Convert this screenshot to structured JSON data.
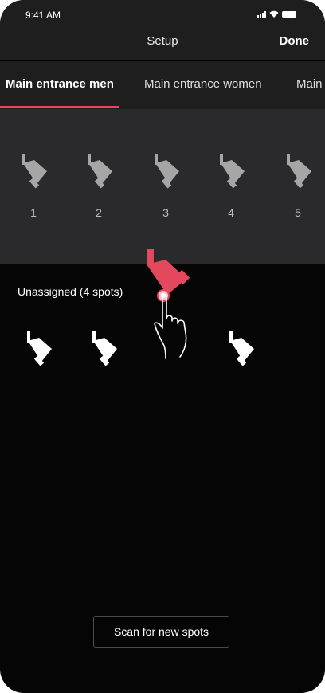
{
  "status_bar": {
    "time": "9:41 AM",
    "icons": [
      "signal-icon",
      "wifi-icon",
      "battery-icon"
    ]
  },
  "nav": {
    "title": "Setup",
    "done_label": "Done"
  },
  "tabs": [
    {
      "label": "Main entrance men",
      "active": true
    },
    {
      "label": "Main entrance women",
      "active": false
    },
    {
      "label": "Main",
      "active": false
    }
  ],
  "assigned_slots": [
    {
      "label": "1",
      "icon": "spotlight-icon"
    },
    {
      "label": "2",
      "icon": "spotlight-icon"
    },
    {
      "label": "3",
      "icon": "spotlight-icon"
    },
    {
      "label": "4",
      "icon": "spotlight-icon"
    },
    {
      "label": "5",
      "icon": "spotlight-icon"
    }
  ],
  "unassigned": {
    "label": "Unassigned (4 spots)",
    "visible_spots": 3
  },
  "scan_button": {
    "label": "Scan for new spots"
  },
  "colors": {
    "accent": "#e3485c",
    "assigned_spot": "#a6a6a6",
    "unassigned_spot": "#ffffff",
    "panel_background": "#2a2a2c",
    "background": "#050505"
  }
}
